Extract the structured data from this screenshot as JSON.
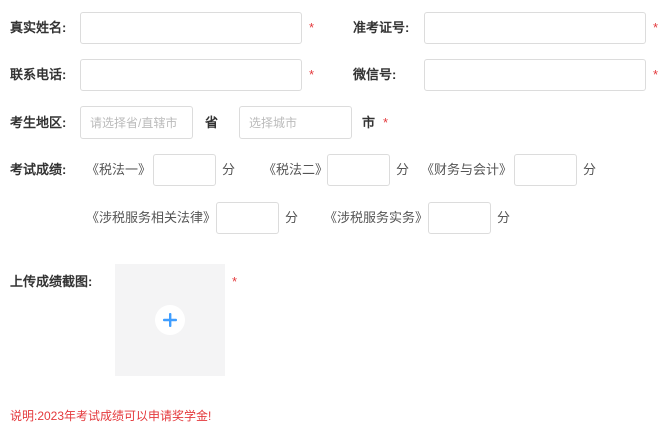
{
  "fields": {
    "name": {
      "label": "真实姓名:",
      "value": "",
      "required": "*"
    },
    "ticket": {
      "label": "准考证号:",
      "value": "",
      "required": "*"
    },
    "phone": {
      "label": "联系电话:",
      "value": "",
      "required": "*"
    },
    "wechat": {
      "label": "微信号:",
      "value": "",
      "required": "*"
    },
    "region": {
      "label": "考生地区:",
      "province_placeholder": "请选择省/直辖市",
      "province_suffix": "省",
      "city_placeholder": "选择城市",
      "city_suffix": "市",
      "required": "*"
    }
  },
  "scores": {
    "label": "考试成绩:",
    "unit": "分",
    "subjects": [
      {
        "name": "《税法一》",
        "value": ""
      },
      {
        "name": "《税法二》",
        "value": ""
      },
      {
        "name": "《财务与会计》",
        "value": ""
      },
      {
        "name": "《涉税服务相关法律》",
        "value": ""
      },
      {
        "name": "《涉税服务实务》",
        "value": ""
      }
    ]
  },
  "upload": {
    "label": "上传成绩截图:",
    "required": "*",
    "icon": "plus-icon"
  },
  "note": "说明:2023年考试成绩可以申请奖学金!",
  "colors": {
    "required": "#e4393c",
    "accent": "#409eff",
    "border": "#dcdcdc"
  }
}
